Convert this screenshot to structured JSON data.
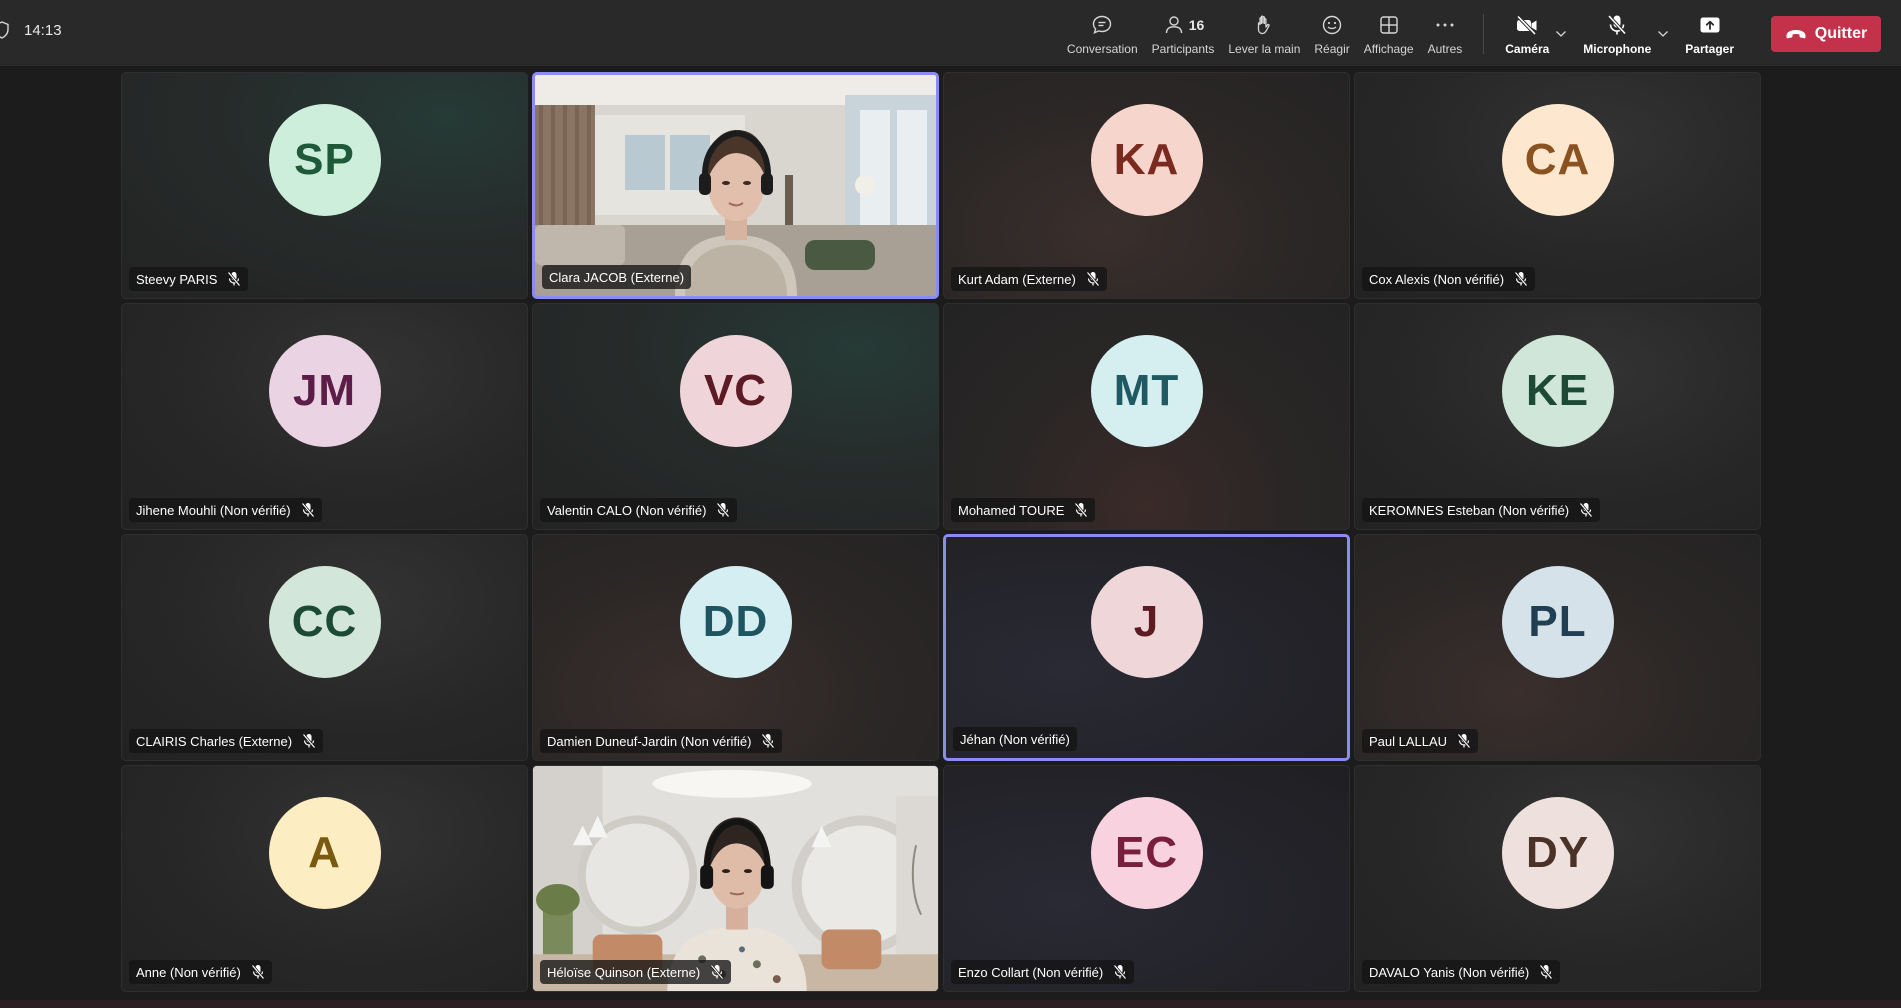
{
  "toolbar": {
    "time": "14:13",
    "items": [
      {
        "label": "Conversation",
        "icon": "chat-icon"
      },
      {
        "label": "Participants",
        "icon": "people-icon",
        "count": "16"
      },
      {
        "label": "Lever la main",
        "icon": "raise-hand-icon"
      },
      {
        "label": "Réagir",
        "icon": "react-icon"
      },
      {
        "label": "Affichage",
        "icon": "view-icon"
      },
      {
        "label": "Autres",
        "icon": "more-icon"
      }
    ],
    "camera_label": "Caméra",
    "microphone_label": "Microphone",
    "share_label": "Partager",
    "quit_label": "Quitter"
  },
  "colors": {
    "toolbar_bg": "#292929",
    "quit_red": "#c4314b",
    "active_border": "#8b8cf0"
  },
  "participants": [
    {
      "name": "Steevy PARIS",
      "initials": "SP",
      "bg": "#cdeedb",
      "fg": "#1e5a3a",
      "muted": true
    },
    {
      "name": "Clara JACOB (Externe)",
      "initials": "",
      "video": true,
      "muted": false
    },
    {
      "name": "Kurt Adam (Externe)",
      "initials": "KA",
      "bg": "#f6d6cc",
      "fg": "#7a2a1e",
      "muted": true
    },
    {
      "name": "Cox Alexis (Non vérifié)",
      "initials": "CA",
      "bg": "#fde8cf",
      "fg": "#8a5220",
      "muted": true
    },
    {
      "name": "Jihene Mouhli (Non vérifié)",
      "initials": "JM",
      "bg": "#ead3e3",
      "fg": "#5c1e48",
      "muted": true
    },
    {
      "name": "Valentin CALO (Non vérifié)",
      "initials": "VC",
      "bg": "#efd5d9",
      "fg": "#5c1a24",
      "muted": true
    },
    {
      "name": "Mohamed TOURE",
      "initials": "MT",
      "bg": "#d5eef0",
      "fg": "#1f5a62",
      "muted": true
    },
    {
      "name": "KEROMNES Esteban (Non vérifié)",
      "initials": "KE",
      "bg": "#cfe6d8",
      "fg": "#1c4a33",
      "muted": true
    },
    {
      "name": "CLAIRIS Charles (Externe)",
      "initials": "CC",
      "bg": "#d2e6da",
      "fg": "#1d4a36",
      "muted": true
    },
    {
      "name": "Damien Duneuf-Jardin (Non vérifié)",
      "initials": "DD",
      "bg": "#d5eef2",
      "fg": "#1f5560",
      "muted": true
    },
    {
      "name": "Jéhan (Non vérifié)",
      "initials": "J",
      "bg": "#efd6d8",
      "fg": "#5c1a22",
      "muted": false
    },
    {
      "name": "Paul LALLAU",
      "initials": "PL",
      "bg": "#d5e2ea",
      "fg": "#223e52",
      "muted": true
    },
    {
      "name": "Anne (Non vérifié)",
      "initials": "A",
      "bg": "#fdedc2",
      "fg": "#7a5a10",
      "muted": true
    },
    {
      "name": "Héloïse Quinson (Externe)",
      "initials": "",
      "video": true,
      "muted": true
    },
    {
      "name": "Enzo Collart (Non vérifié)",
      "initials": "EC",
      "bg": "#f8d3df",
      "fg": "#7a1e3e",
      "muted": true
    },
    {
      "name": "DAVALO Yanis (Non vérifié)",
      "initials": "DY",
      "bg": "#eee0dc",
      "fg": "#4a3226",
      "muted": true
    }
  ]
}
